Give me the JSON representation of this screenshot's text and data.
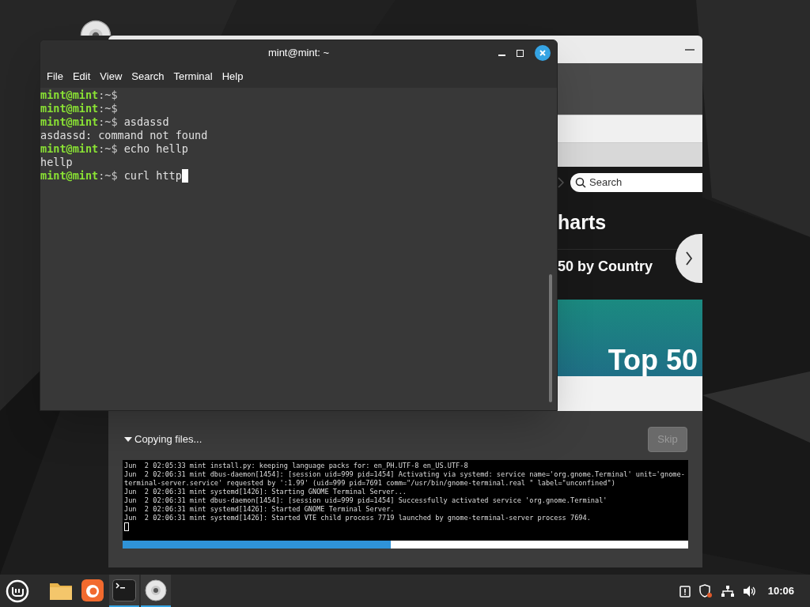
{
  "terminal": {
    "title": "mint@mint: ~",
    "menu": [
      "File",
      "Edit",
      "View",
      "Search",
      "Terminal",
      "Help"
    ],
    "lines": [
      {
        "kind": "prompt",
        "user": "mint@mint",
        "path": ":~$",
        "cursor": false
      },
      {
        "kind": "prompt",
        "user": "mint@mint",
        "path": ":~$",
        "cursor": false
      },
      {
        "kind": "prompt",
        "user": "mint@mint",
        "path": ":~$",
        "command": " asdassd",
        "cursor": false
      },
      {
        "kind": "output",
        "text": "asdassd: command not found"
      },
      {
        "kind": "prompt",
        "user": "mint@mint",
        "path": ":~$",
        "command": " echo hellp",
        "cursor": false
      },
      {
        "kind": "output",
        "text": "hellp"
      },
      {
        "kind": "prompt",
        "user": "mint@mint",
        "path": ":~$",
        "command": " curl http",
        "cursor": true
      }
    ]
  },
  "installer": {
    "slide": {
      "search_placeholder": "Search",
      "heading": "harts",
      "subheading": "50 by Country",
      "banner": "Top 50"
    },
    "status": "Copying files...",
    "expanded": true,
    "skip": {
      "label": "Skip",
      "disabled": true
    },
    "log": [
      "Jun  2 02:05:33 mint install.py: keeping language packs for: en_PH.UTF-8 en_US.UTF-8",
      "Jun  2 02:06:31 mint dbus-daemon[1454]: [session uid=999 pid=1454] Activating via systemd: service name='org.gnome.Terminal' unit='gnome-terminal-server.service' requested by ':1.99' (uid=999 pid=7691 comm=\"/usr/bin/gnome-terminal.real \" label=\"unconfined\")",
      "Jun  2 02:06:31 mint systemd[1426]: Starting GNOME Terminal Server...",
      "Jun  2 02:06:31 mint dbus-daemon[1454]: [session uid=999 pid=1454] Successfully activated service 'org.gnome.Terminal'",
      "Jun  2 02:06:31 mint systemd[1426]: Started GNOME Terminal Server.",
      "Jun  2 02:06:31 mint systemd[1426]: Started VTE child process 7719 launched by gnome-terminal-server process 7694."
    ],
    "progress": {
      "level": 0.474
    }
  },
  "taskbar": {
    "apps": [
      {
        "kind": "folder",
        "active": false
      },
      {
        "kind": "firefox",
        "active": false
      },
      {
        "kind": "terminal",
        "active": true
      },
      {
        "kind": "disc",
        "active": true
      }
    ],
    "clock": "10:06"
  }
}
